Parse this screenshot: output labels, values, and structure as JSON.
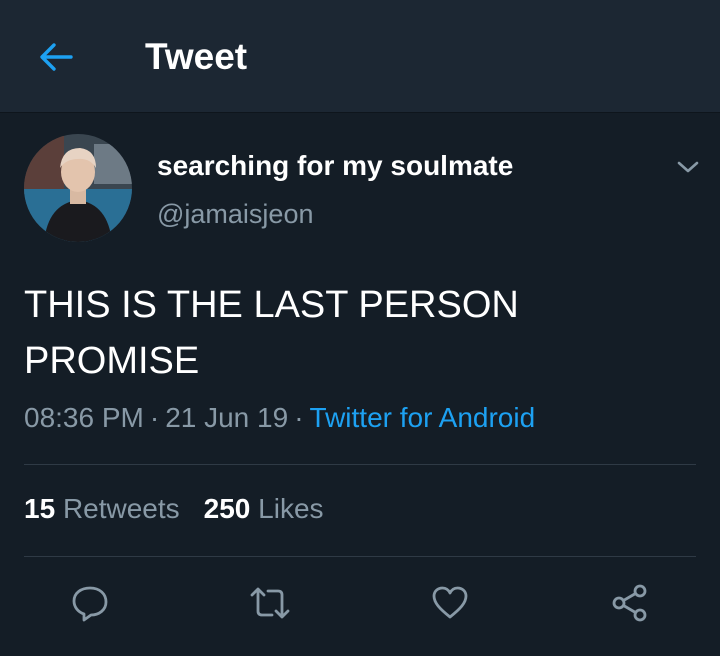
{
  "header": {
    "title": "Tweet",
    "back_icon": "arrow-left-icon"
  },
  "tweet": {
    "author_name": "searching for my soulmate",
    "author_handle": "@jamaisjeon",
    "text_line1": "THIS IS THE LAST PERSON",
    "text_line2": "PROMISE",
    "time": "08:36 PM",
    "date": "21 Jun 19",
    "separator": "·",
    "source": "Twitter for Android",
    "retweets_count": "15",
    "retweets_label": "Retweets",
    "likes_count": "250",
    "likes_label": "Likes"
  },
  "actions": [
    "reply-icon",
    "retweet-icon",
    "like-icon",
    "share-icon"
  ],
  "colors": {
    "background": "#141d26",
    "header_bg": "#1c2733",
    "accent": "#1da1f2",
    "muted": "#8899a6"
  }
}
